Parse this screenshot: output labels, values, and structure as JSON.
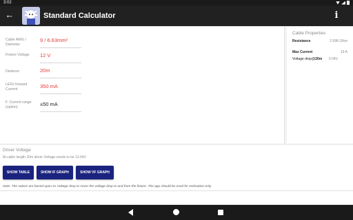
{
  "status": {
    "time": "3:02"
  },
  "appbar": {
    "title": "Standard Calculator",
    "back_icon": "←",
    "info_icon": "i"
  },
  "form": [
    {
      "label": "Cable AWG / Diameter",
      "value": "9 / 6.63mm²",
      "color": "red"
    },
    {
      "label": "Fixture Voltage",
      "value": "12 V",
      "color": "red"
    },
    {
      "label": "Distance",
      "value": "20m",
      "color": "red"
    },
    {
      "label": "LEDs forward Current",
      "value": "350 mA",
      "color": "red"
    },
    {
      "label": "F. Current range (option)",
      "value": "±50 mA",
      "color": "black"
    }
  ],
  "properties": {
    "title": "Cable Properties",
    "resistance": {
      "label": "Resistance",
      "value": "2.598 Ω/km"
    },
    "max_current": {
      "label": "Max Current",
      "value": "19 A"
    },
    "voltage_drop": {
      "label_pre": "Voltage drop@",
      "label_bold": "20m",
      "value": "0.04V"
    }
  },
  "driver": {
    "title": "Driver Voltage",
    "text": "At cable length 20m driver Voltage needs to be 12.04V",
    "buttons": [
      "SHOW TABLE",
      "SHOW IF GRAPH",
      "SHOW VF GRAPH"
    ],
    "note": "Note: The values are based upon 2x Voltage drop to cover the voltage drop to and from the fixture. The app should be used for estimation only"
  },
  "colors": {
    "accent": "#e53935",
    "button": "#1a237e",
    "appbar": "#212121"
  }
}
